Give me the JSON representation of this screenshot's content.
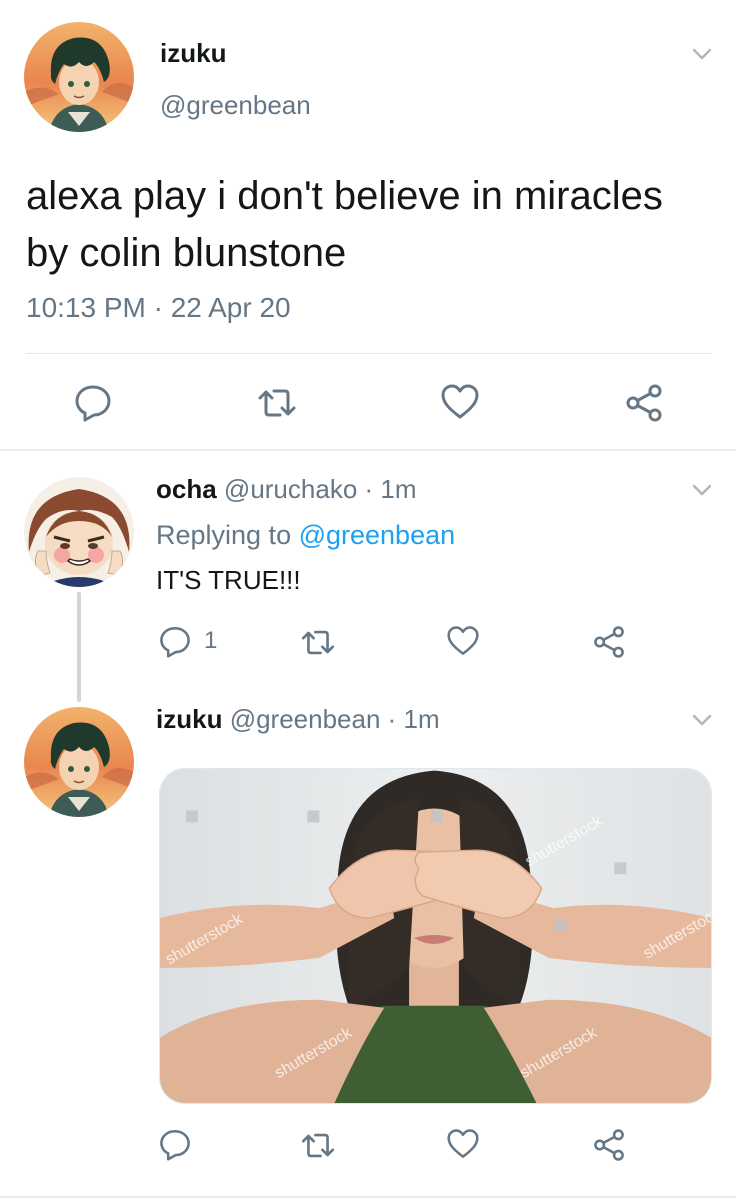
{
  "main_tweet": {
    "author_name": "izuku",
    "author_handle": "@greenbean",
    "text": "alexa play i don't believe in miracles by colin blunstone",
    "timestamp": "10:13 PM · 22 Apr 20",
    "actions": {
      "reply_icon": "reply-icon",
      "retweet_icon": "retweet-icon",
      "like_icon": "heart-icon",
      "share_icon": "share-icon"
    }
  },
  "replies": [
    {
      "author_name": "ocha",
      "author_handle": "@uruchako",
      "separator": " · ",
      "time": "1m",
      "replying_prefix": "Replying to ",
      "replying_to": "@greenbean",
      "text": "IT'S TRUE!!!",
      "reply_count": "1"
    },
    {
      "author_name": "izuku",
      "author_handle": "@greenbean",
      "separator": " · ",
      "time": "1m",
      "media": "stock photo of a woman covering her eyes with her hands",
      "watermark": "shutterstock"
    }
  ],
  "colors": {
    "text_primary": "#14171a",
    "text_secondary": "#657786",
    "link": "#1da1f2",
    "divider": "#e1e8ed"
  }
}
